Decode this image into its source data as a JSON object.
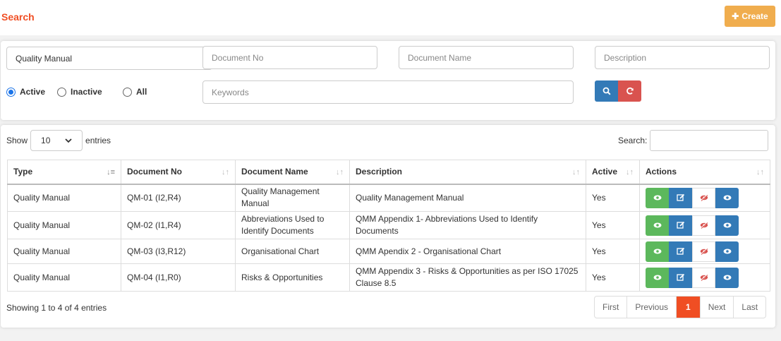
{
  "header": {
    "title": "Search",
    "create_label": "Create"
  },
  "filters": {
    "type_value": "Quality Manual",
    "doc_no_placeholder": "Document No",
    "doc_name_placeholder": "Document Name",
    "description_placeholder": "Description",
    "keywords_placeholder": "Keywords",
    "radios": {
      "active": "Active",
      "inactive": "Inactive",
      "all": "All",
      "selected": "Active"
    }
  },
  "list": {
    "show_label": "Show",
    "entries_value": "10",
    "entries_label": "entries",
    "search_label": "Search:",
    "columns": [
      "Type",
      "Document No",
      "Document Name",
      "Description",
      "Active",
      "Actions"
    ],
    "rows": [
      {
        "type": "Quality Manual",
        "doc_no": "QM-01 (I2,R4)",
        "name": "Quality Management Manual",
        "desc": "Quality Management Manual",
        "active": "Yes"
      },
      {
        "type": "Quality Manual",
        "doc_no": "QM-02 (I1,R4)",
        "name": "Abbreviations Used to Identify Documents",
        "desc": "QMM Appendix 1- Abbreviations Used to Identify Documents",
        "active": "Yes"
      },
      {
        "type": "Quality Manual",
        "doc_no": "QM-03 (I3,R12)",
        "name": "Organisational Chart",
        "desc": "QMM Apendix 2 - Organisational Chart",
        "active": "Yes"
      },
      {
        "type": "Quality Manual",
        "doc_no": "QM-04 (I1,R0)",
        "name": "Risks & Opportunities",
        "desc": "QMM Appendix 3 - Risks & Opportunities as per ISO 17025 Clause 8.5",
        "active": "Yes"
      }
    ],
    "info": "Showing 1 to 4 of 4 entries",
    "pager": {
      "first": "First",
      "previous": "Previous",
      "current": "1",
      "next": "Next",
      "last": "Last"
    }
  },
  "colors": {
    "accent": "#f04e23",
    "create": "#f0ad4e",
    "primary": "#337ab7",
    "danger": "#d9534f",
    "success": "#5cb85c"
  }
}
